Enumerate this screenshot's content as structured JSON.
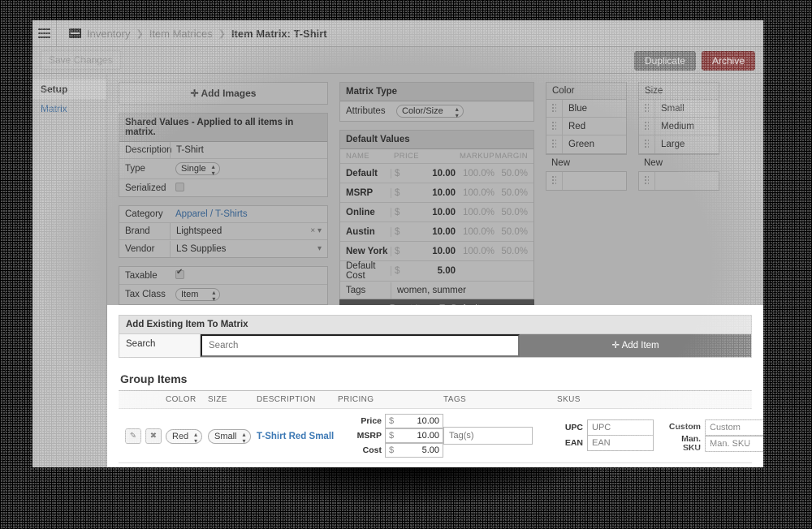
{
  "topbar": {
    "menu_icon": "hamburger-icon",
    "breadcrumb_icon": "inventory-box-icon",
    "breadcrumb": [
      "Inventory",
      "Item Matrices"
    ],
    "separator": "❯",
    "current": "Item Matrix: T-Shirt"
  },
  "actionbar": {
    "save_label": "Save Changes",
    "duplicate_label": "Duplicate",
    "archive_label": "Archive",
    "archive_color": "#7e3333"
  },
  "sidebar": {
    "items": [
      {
        "label": "Setup",
        "active": true
      },
      {
        "label": "Matrix",
        "active": false
      }
    ]
  },
  "images": {
    "add_label": "✛ Add Images"
  },
  "shared": {
    "title": "Shared Values - Applied to all items in matrix.",
    "description_label": "Description",
    "description_value": "T-Shirt",
    "type_label": "Type",
    "type_value": "Single",
    "serialized_label": "Serialized",
    "serialized_checked": false
  },
  "category": {
    "category_label": "Category",
    "category_value": "Apparel / T-Shirts",
    "brand_label": "Brand",
    "brand_value": "Lightspeed",
    "vendor_label": "Vendor",
    "vendor_value": "LS Supplies"
  },
  "tax": {
    "taxable_label": "Taxable",
    "taxable_checked": true,
    "tax_class_label": "Tax Class",
    "tax_class_value": "Item"
  },
  "matrix_type": {
    "title": "Matrix Type",
    "attributes_label": "Attributes",
    "attributes_value": "Color/Size"
  },
  "default_values": {
    "title": "Default Values",
    "columns": [
      "NAME",
      "PRICE",
      "MARKUP",
      "MARGIN"
    ],
    "currency": "$",
    "rows": [
      {
        "name": "Default",
        "price": "10.00",
        "markup": "100.0%",
        "margin": "50.0%"
      },
      {
        "name": "MSRP",
        "price": "10.00",
        "markup": "100.0%",
        "margin": "50.0%"
      },
      {
        "name": "Online",
        "price": "10.00",
        "markup": "100.0%",
        "margin": "50.0%"
      },
      {
        "name": "Austin",
        "price": "10.00",
        "markup": "100.0%",
        "margin": "50.0%"
      },
      {
        "name": "New York",
        "price": "10.00",
        "markup": "100.0%",
        "margin": "50.0%"
      }
    ],
    "default_cost_label": "Default Cost",
    "default_cost_value": "5.00",
    "tags_label": "Tags",
    "tags_value": "women, summer",
    "reset_label": "Reset Items To Defaults"
  },
  "color_panel": {
    "title": "Color",
    "options": [
      "Blue",
      "Red",
      "Green"
    ],
    "new_label": "New"
  },
  "size_panel": {
    "title": "Size",
    "options": [
      "Small",
      "Medium",
      "Large"
    ],
    "new_label": "New"
  },
  "add_existing": {
    "title": "Add Existing Item To Matrix",
    "search_label": "Search",
    "search_placeholder": "Search",
    "search_value": "",
    "add_item_label": "✛ Add Item"
  },
  "group_items": {
    "title": "Group Items",
    "columns": [
      "COLOR",
      "SIZE",
      "DESCRIPTION",
      "PRICING",
      "TAGS",
      "SKUS"
    ],
    "rows": [
      {
        "edit_icon": "pencil-icon",
        "delete_icon": "close-x-icon",
        "color": "Red",
        "size": "Small",
        "description": "T-Shirt Red Small",
        "currency": "$",
        "price_label": "Price",
        "price_value": "10.00",
        "msrp_label": "MSRP",
        "msrp_value": "10.00",
        "cost_label": "Cost",
        "cost_value": "5.00",
        "tags_placeholder": "Tag(s)",
        "tags_value": "",
        "upc_label": "UPC",
        "upc_placeholder": "UPC",
        "upc_value": "",
        "ean_label": "EAN",
        "ean_placeholder": "EAN",
        "ean_value": "",
        "custom_label": "Custom",
        "custom_placeholder": "Custom",
        "custom_value": "",
        "man_sku_label": "Man. SKU",
        "man_sku_placeholder": "Man. SKU",
        "man_sku_value": ""
      }
    ]
  }
}
